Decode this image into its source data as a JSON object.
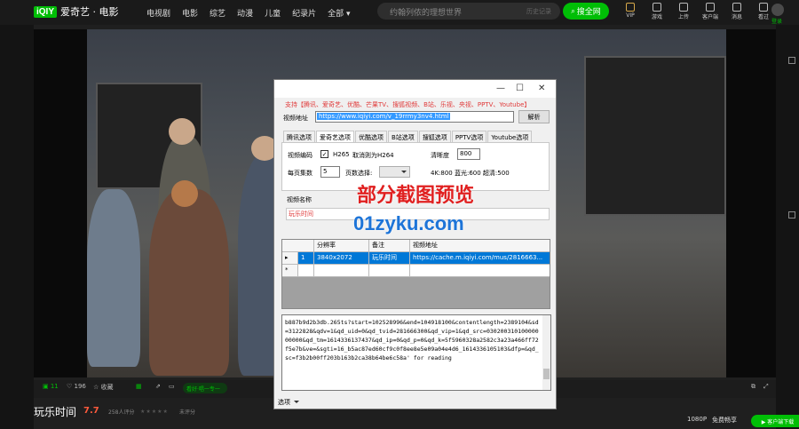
{
  "site": {
    "logo_badge": "iQIY",
    "logo_text": "爱奇艺 · 电影",
    "nav": [
      "电视剧",
      "电影",
      "综艺",
      "动漫",
      "儿童",
      "纪录片",
      "全部 ▾"
    ],
    "search_placeholder": "约翰列侬的理想世界",
    "search_hint": "历史记录",
    "search_button": "搜全网",
    "top_icons": [
      "VIP",
      "游戏",
      "上传",
      "客户端",
      "消息",
      "看过",
      "登录"
    ]
  },
  "player": {
    "likes": "11",
    "views": "196",
    "favorite": "收藏",
    "share_pill": "看好·唱一专一",
    "resolution": "1080P",
    "free_trial": "免费畅享",
    "client_button": "▶ 客户端下载"
  },
  "movie": {
    "title": "玩乐时间",
    "score": "7.7",
    "score_count": "258人评分",
    "rating_stars": "★★★★★",
    "rating_label": "未评分"
  },
  "app": {
    "support_text": "支持【腾讯、爱奇艺、优酷、芒果TV、搜狐视频、B站、乐视、央视、PPTV、Youtube】",
    "url_label": "视频地址",
    "url_value": "https://www.iqiyi.com/v_19rrmy3nv4.html",
    "parse_button": "解析",
    "tabs": [
      "腾讯选项",
      "爱奇艺选项",
      "优酷选项",
      "B站选项",
      "搜狐选项",
      "PPTV选项",
      "Youtube选项"
    ],
    "active_tab": 1,
    "codec_label": "视频编码",
    "h265_checked": true,
    "h265_label": "H265",
    "h265_hint": "取消则为H264",
    "clarity_label": "清晰度",
    "clarity_value": "800",
    "per_page_label": "每页集数",
    "per_page_value": "5",
    "page_select_label": "页数选择:",
    "quality_hint": "4K:800 蓝光:600 超清:500",
    "name_label": "视频名称",
    "name_value": "玩乐时间",
    "grid_headers": [
      "分辨率",
      "备注",
      "视频地址"
    ],
    "grid_rows": [
      {
        "marker": "▸",
        "index": "1",
        "resolution": "3840x2072",
        "note": "玩乐时间",
        "url": "https://cache.m.iqiyi.com/mus/2816663..."
      },
      {
        "marker": "*",
        "index": "",
        "resolution": "",
        "note": "",
        "url": ""
      }
    ],
    "log_text": "b887b9d2b3db.265ts?start=102528996&end=104918100&contentlength=2389104&sd=3122828&qdv=1&qd_uid=0&qd_tvid=281666300&qd_vip=1&qd_src=03020031010000000000&qd_tm=1614336137437&qd_ip=0&qd_p=0&qd_k=5f5960328a2582c3a23a466ff72f5e7b&ve=&sgti=16_b5ac87ed60cf9c0f8ee8e5e09a04e4d6_1614336105103&dfp=&qd_sc=f3b2b00ff203b163b2ca38b64be6c58a' for reading",
    "menu_label": "选项"
  },
  "watermark": {
    "line1": "部分截图预览",
    "line2": "01zyku.com"
  },
  "colors": {
    "brand_green": "#00be06",
    "selection_blue": "#0078d7",
    "support_red": "#e03a3a",
    "score_orange": "#ff5a3c"
  }
}
